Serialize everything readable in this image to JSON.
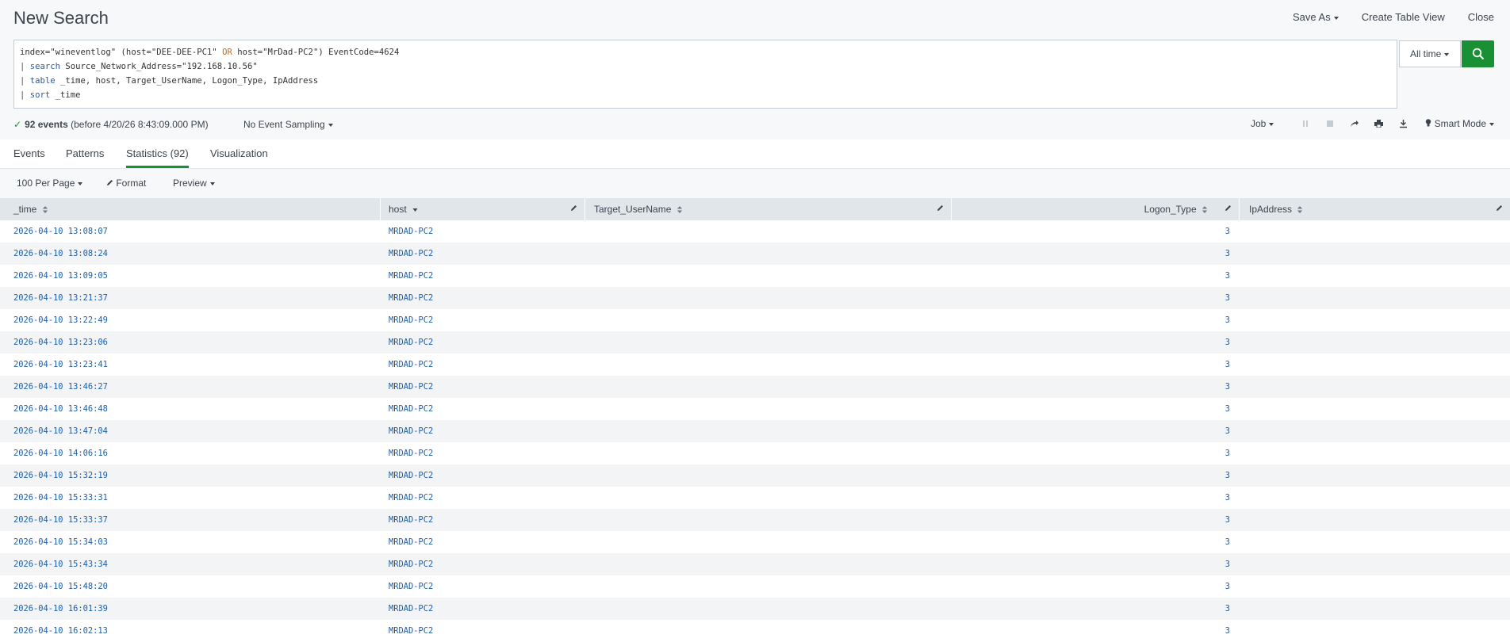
{
  "header": {
    "title": "New Search",
    "save_as": "Save As",
    "create_table_view": "Create Table View",
    "close": "Close"
  },
  "search": {
    "line1": {
      "a": "index=\"wineventlog\" (host=\"DEE-DEE-PC1\" ",
      "or": "OR",
      "b": " host=\"MrDad-PC2\") EventCode=4624"
    },
    "line2": {
      "pipe": "| ",
      "cmd": "search",
      "rest": " Source_Network_Address=\"192.168.10.56\""
    },
    "line3": {
      "pipe": "| ",
      "cmd": "table",
      "rest": " _time, host, Target_UserName, Logon_Type, IpAddress"
    },
    "line4": {
      "pipe": "| ",
      "cmd": "sort",
      "rest": " _time"
    },
    "time_range": "All time"
  },
  "status": {
    "count": "92 events",
    "detail": "(before 4/20/26 8:43:09.000 PM)",
    "sampling": "No Event Sampling",
    "job": "Job",
    "mode": "Smart Mode"
  },
  "tabs": {
    "events": "Events",
    "patterns": "Patterns",
    "statistics": "Statistics (92)",
    "visualization": "Visualization"
  },
  "options": {
    "per_page": "100 Per Page",
    "format": "Format",
    "preview": "Preview"
  },
  "columns": {
    "time": "_time",
    "host": "host",
    "target_username": "Target_UserName",
    "logon_type": "Logon_Type",
    "ipaddress": "IpAddress"
  },
  "rows": [
    {
      "time": "2026-04-10 13:08:07",
      "host": "MRDAD-PC2",
      "logon_type": "3"
    },
    {
      "time": "2026-04-10 13:08:24",
      "host": "MRDAD-PC2",
      "logon_type": "3"
    },
    {
      "time": "2026-04-10 13:09:05",
      "host": "MRDAD-PC2",
      "logon_type": "3"
    },
    {
      "time": "2026-04-10 13:21:37",
      "host": "MRDAD-PC2",
      "logon_type": "3"
    },
    {
      "time": "2026-04-10 13:22:49",
      "host": "MRDAD-PC2",
      "logon_type": "3"
    },
    {
      "time": "2026-04-10 13:23:06",
      "host": "MRDAD-PC2",
      "logon_type": "3"
    },
    {
      "time": "2026-04-10 13:23:41",
      "host": "MRDAD-PC2",
      "logon_type": "3"
    },
    {
      "time": "2026-04-10 13:46:27",
      "host": "MRDAD-PC2",
      "logon_type": "3"
    },
    {
      "time": "2026-04-10 13:46:48",
      "host": "MRDAD-PC2",
      "logon_type": "3"
    },
    {
      "time": "2026-04-10 13:47:04",
      "host": "MRDAD-PC2",
      "logon_type": "3"
    },
    {
      "time": "2026-04-10 14:06:16",
      "host": "MRDAD-PC2",
      "logon_type": "3"
    },
    {
      "time": "2026-04-10 15:32:19",
      "host": "MRDAD-PC2",
      "logon_type": "3"
    },
    {
      "time": "2026-04-10 15:33:31",
      "host": "MRDAD-PC2",
      "logon_type": "3"
    },
    {
      "time": "2026-04-10 15:33:37",
      "host": "MRDAD-PC2",
      "logon_type": "3"
    },
    {
      "time": "2026-04-10 15:34:03",
      "host": "MRDAD-PC2",
      "logon_type": "3"
    },
    {
      "time": "2026-04-10 15:43:34",
      "host": "MRDAD-PC2",
      "logon_type": "3"
    },
    {
      "time": "2026-04-10 15:48:20",
      "host": "MRDAD-PC2",
      "logon_type": "3"
    },
    {
      "time": "2026-04-10 16:01:39",
      "host": "MRDAD-PC2",
      "logon_type": "3"
    },
    {
      "time": "2026-04-10 16:02:13",
      "host": "MRDAD-PC2",
      "logon_type": "3"
    }
  ],
  "colors": {
    "accent_green": "#1a9035",
    "link_blue": "#1e5ea8",
    "header_bg": "#f7f8fa",
    "table_head_bg": "#e1e6eb"
  },
  "icons": {
    "search_button": "magnifier-icon",
    "edit": "pencil-icon",
    "sort": "sort-icon"
  }
}
